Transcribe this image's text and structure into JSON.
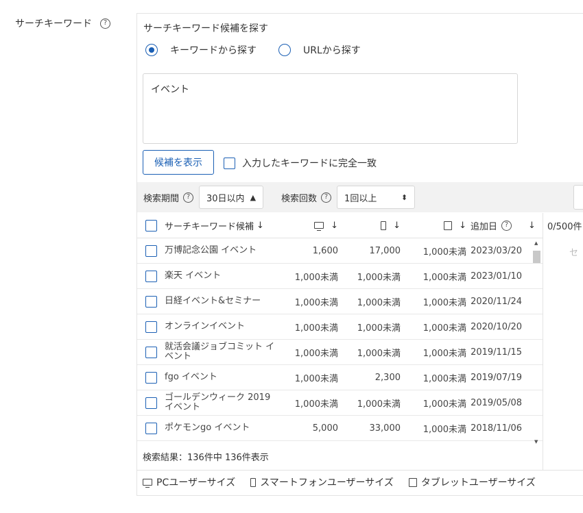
{
  "field_label": "サーチキーワード",
  "help_glyph": "?",
  "panel_title": "サーチキーワード候補を探す",
  "radios": [
    {
      "label": "キーワードから探す",
      "selected": true
    },
    {
      "label": "URLから探す",
      "selected": false
    }
  ],
  "keyword_input": {
    "value": "イベント"
  },
  "suggest_button": "候補を表示",
  "exact_match_label": "入力したキーワードに完全一致",
  "filters": {
    "period_label": "検索期間",
    "period_value": "30日以内",
    "count_label": "検索回数",
    "count_value": "1回以上"
  },
  "table": {
    "headers": {
      "keyword": "サーチキーワード候補",
      "date": "追加日",
      "sort_arrow": "↓"
    },
    "rows": [
      {
        "keyword": "万博記念公園 イベント",
        "pc": "1,600",
        "sp": "17,000",
        "tablet": "1,000未満",
        "date": "2023/03/20"
      },
      {
        "keyword": "楽天 イベント",
        "pc": "1,000未満",
        "sp": "1,000未満",
        "tablet": "1,000未満",
        "date": "2023/01/10"
      },
      {
        "keyword": "日経イベント&セミナー",
        "pc": "1,000未満",
        "sp": "1,000未満",
        "tablet": "1,000未満",
        "date": "2020/11/24"
      },
      {
        "keyword": "オンラインイベント",
        "pc": "1,000未満",
        "sp": "1,000未満",
        "tablet": "1,000未満",
        "date": "2020/10/20"
      },
      {
        "keyword": "就活会議ジョブコミット イベント",
        "pc": "1,000未満",
        "sp": "1,000未満",
        "tablet": "1,000未満",
        "date": "2019/11/15"
      },
      {
        "keyword": "fgo イベント",
        "pc": "1,000未満",
        "sp": "2,300",
        "tablet": "1,000未満",
        "date": "2019/07/19"
      },
      {
        "keyword": "ゴールデンウィーク 2019 イベント",
        "pc": "1,000未満",
        "sp": "1,000未満",
        "tablet": "1,000未満",
        "date": "2019/05/08"
      },
      {
        "keyword": "ポケモンgo イベント",
        "pc": "5,000",
        "sp": "33,000",
        "tablet": "1,000未満",
        "date": "2018/11/06"
      }
    ]
  },
  "selected_count": "0/500件",
  "right_ghost_text": "セ",
  "results_text": "検索結果：136件中 136件表示",
  "legend": {
    "pc": "PCユーザーサイズ",
    "sp": "スマートフォンユーザーサイズ",
    "tablet": "タブレットユーザーサイズ"
  },
  "colors": {
    "accent": "#1a5fb4",
    "filter_bg": "#f2f2f2"
  }
}
